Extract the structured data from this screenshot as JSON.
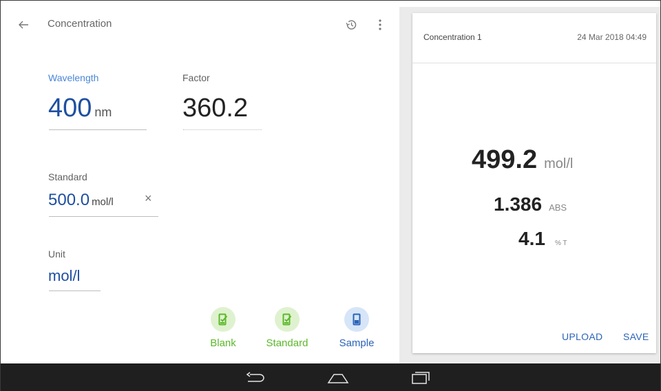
{
  "toolbar": {
    "title": "Concentration",
    "back_icon": "arrow-back-icon",
    "history_icon": "history-icon",
    "more_icon": "more-vert-icon"
  },
  "form": {
    "wavelength": {
      "label": "Wavelength",
      "value": "400",
      "unit": "nm"
    },
    "factor": {
      "label": "Factor",
      "value": "360.2"
    },
    "standard": {
      "label": "Standard",
      "value": "500.0",
      "unit": "mol/l",
      "clear": "×"
    },
    "unit": {
      "label": "Unit",
      "value": "mol/l"
    }
  },
  "actions": [
    {
      "label": "Blank",
      "color": "#5bb82a",
      "bg": "#dff2cf",
      "icon": "cuvette-check-icon"
    },
    {
      "label": "Standard",
      "color": "#5bb82a",
      "bg": "#dff2cf",
      "icon": "cuvette-check-icon"
    },
    {
      "label": "Sample",
      "color": "#2b63b8",
      "bg": "#d6e5f8",
      "icon": "cuvette-icon"
    }
  ],
  "result": {
    "title": "Concentration 1",
    "date": "24 Mar 2018 04:49",
    "main_value": "499.2",
    "main_unit": "mol/l",
    "abs_value": "1.386",
    "abs_unit": "ABS",
    "t_value": "4.1",
    "t_unit": "% T",
    "upload_label": "UPLOAD",
    "save_label": "SAVE"
  },
  "navbar": {
    "back_icon": "nav-back-icon",
    "home_icon": "nav-home-icon",
    "recents_icon": "nav-recents-icon"
  },
  "colors": {
    "accent_blue": "#2b63b8",
    "active_label": "#4a86d8",
    "green": "#5bb82a"
  }
}
